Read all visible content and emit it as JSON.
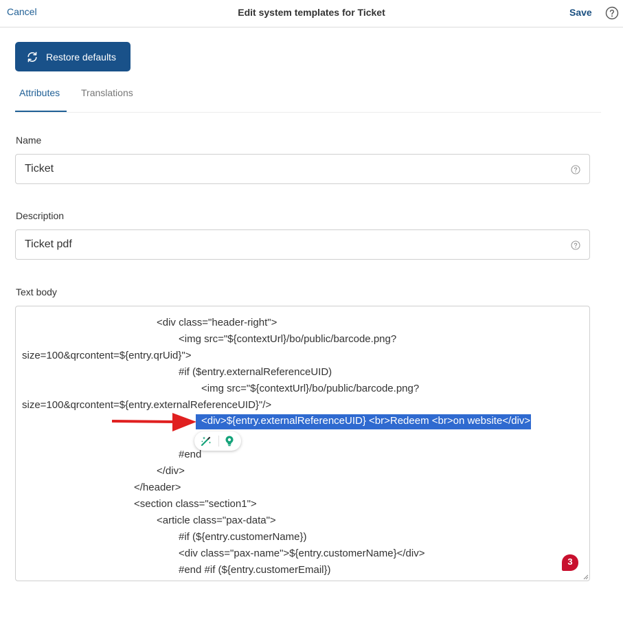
{
  "header": {
    "cancel_label": "Cancel",
    "title": "Edit system templates for Ticket",
    "save_label": "Save",
    "help_icon": "question-circle-icon"
  },
  "toolbar": {
    "restore_label": "Restore defaults",
    "restore_icon": "refresh-icon"
  },
  "tabs": [
    {
      "label": "Attributes",
      "active": true
    },
    {
      "label": "Translations",
      "active": false
    }
  ],
  "fields": {
    "name": {
      "label": "Name",
      "value": "Ticket"
    },
    "description": {
      "label": "Description",
      "value": "Ticket pdf"
    },
    "text_body": {
      "label": "Text body",
      "lines": [
        "<div class=\"header-right\">",
        "<img src=\"${contextUrl}/bo/public/barcode.png?",
        "size=100&qrcontent=${entry.qrUid}\">",
        "#if ($entry.externalReferenceUID)",
        "<img src=\"${contextUrl}/bo/public/barcode.png?",
        "size=100&qrcontent=${entry.externalReferenceUID}\"/>",
        "<div>${entry.externalReferenceUID} <br>Redeem <br>on website</div>",
        "#end",
        "</div>",
        "</header>",
        "<section class=\"section1\">",
        "<article class=\"pax-data\">",
        "#if (${entry.customerName})",
        "<div class=\"pax-name\">${entry.customerName}</div>",
        "#end #if (${entry.customerEmail})"
      ]
    }
  },
  "selection_toolbar": {
    "icons": [
      "magic-wand-icon",
      "lightbulb-icon"
    ]
  },
  "notification_badge": {
    "count": "3"
  },
  "colors": {
    "accent": "#195189",
    "link": "#1f5f95",
    "selection": "#2f6ad0",
    "arrow": "#e02020",
    "badge": "#c8102e",
    "bulb": "#15a37a"
  }
}
